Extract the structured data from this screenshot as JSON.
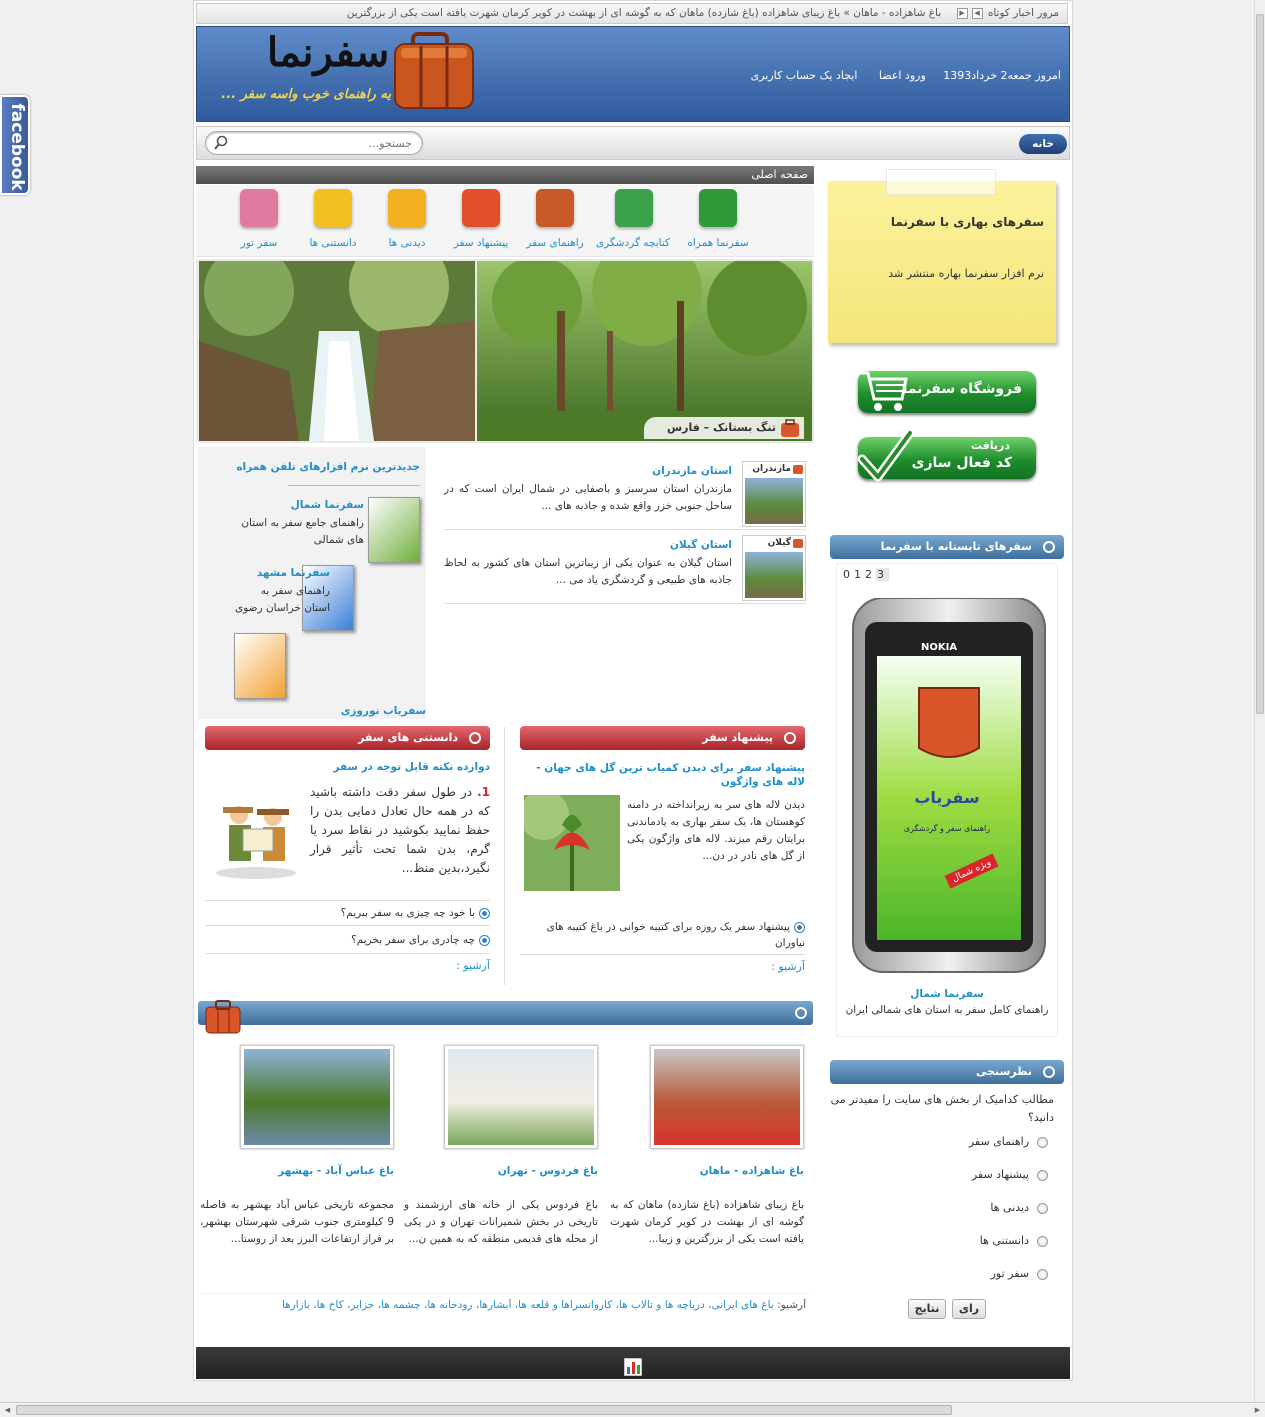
{
  "facebook": {
    "label": "facebook"
  },
  "ticker": {
    "label": "مرور اخبار کوتاه",
    "text": "باغ شاهزاده - ماهان  »  باغ زیبای شاهزاده (باغ شازده) ماهان که به گوشه ای از بهشت در کویر کرمان شهرت یافته است یکی از بزرگترین"
  },
  "header": {
    "logo_text": "سفرنما",
    "logo_slogan": "یه راهنمای خوب واسه سفر ...",
    "date": "امروز جمعه2 خرداد1393",
    "login": "ورود اعضا",
    "register": "ایجاد یک حساب کاربری"
  },
  "toolbar": {
    "home": "خانه",
    "search_placeholder": "جستجو..."
  },
  "main": {
    "breadcrumb": "صفحه اصلی",
    "categories": [
      {
        "label": "سفرنما همراه",
        "icon": "phone-suitcase-icon",
        "color": "#2e9a3a"
      },
      {
        "label": "کتابچه گردشگری",
        "icon": "book-icon",
        "color": "#3aa24a"
      },
      {
        "label": "راهنمای سفر",
        "icon": "signpost-icon",
        "color": "#c85a2a"
      },
      {
        "label": "پیشنهاد سفر",
        "icon": "bag-icon",
        "color": "#e0502a"
      },
      {
        "label": "دیدنی ها",
        "icon": "sun-cloud-icon",
        "color": "#f3b020"
      },
      {
        "label": "دانستنی ها",
        "icon": "question-icon",
        "color": "#f0c020"
      },
      {
        "label": "سفر تور",
        "icon": "backpack-icon",
        "color": "#e07aa0"
      }
    ],
    "slider_caption": "تنگ بستانک – فارس",
    "provinces": [
      {
        "tag": "مازندران",
        "title": "استان مازندران",
        "desc": "مازندران استان سرسبز و باصفایی در شمال ایران است که در ساحل جنوبی خزر واقع شده و جاذبه های ..."
      },
      {
        "tag": "گیلان",
        "title": "استان گیلان",
        "desc": "استان گیلان به عنوان یکی از زیباترین استان های کشور به لحاظ جاذبه های طبیعی و گردشگری یاد می ..."
      }
    ],
    "apps": {
      "heading": "جدیدترین نرم افزارهای تلفن همراه",
      "items": [
        {
          "title": "سفرنما شمال",
          "desc": "راهنمای جامع سفر به استان های شمالی"
        },
        {
          "title": "سفرنما مشهد",
          "desc": "راهنمای سفر به استان خراسان رضوی"
        },
        {
          "title": "سفریاب نوروزی",
          "desc": ""
        }
      ]
    },
    "suggest": {
      "heading": "پیشنهاد سفر",
      "title": "پیشنهاد سفر برای دیدن کمیاب ترین گل های جهان - لاله های واژگون",
      "body": "دیدن لاله های سر به زیرانداخته در دامنه کوهستان ها، یک سفر بهاری به یادماندنی برایتان رقم میزند. لاله های واژگون یکی از گل های نادر در دن...",
      "links": [
        "پیشنهاد سفر یک روزه برای کتیبه خوانی در باغ کتیبه های نیاوران"
      ],
      "archive": "آرشیو :"
    },
    "facts": {
      "heading": "دانستنی های سفر",
      "title": "دوازده نکته قابل توجه در سفر",
      "num": "1.",
      "body": "در طول سفر دقت داشته باشید که در همه حال تعادل دمایی بدن را حفظ نمایید بکوشید در نقاط سرد یا گرم، بدن شما تحت تأثیر قرار نگیرد،بدین منظ...",
      "links": [
        "با خود چه چیزی به سفر ببریم؟",
        "چه چادری برای سفر بخریم؟"
      ],
      "archive": "آرشیو :"
    },
    "gardens": [
      {
        "title": "باغ شاهزاده - ماهان",
        "desc": "باغ زیبای شاهزاده (باغ شازده) ماهان که به گوشه ای از بهشت در کویر کرمان شهرت یافته است یکی از بزرگترین و زیبا..."
      },
      {
        "title": "باغ فردوس - تهران",
        "desc": "باغ فردوس یکی از خانه های ارزشمند و تاریخی در بخش شمیرانات تهران و در یکی از محله های قدیمی منطقه که به همین ن..."
      },
      {
        "title": "باغ عباس آباد - بهشهر",
        "desc": "مجموعه تاریخی عباس آباد بهشهر به فاصله 9 کیلومتری جنوب شرقی شهرستان بهشهر، بر فراز ارتفاعات البرز بعد از روستا..."
      }
    ],
    "archive_label": "آرشیو:",
    "archive_links": "باغ های ایرانی، دریاچه ها و تالاب ها، کاروانسراها و قلعه ها، آبشارها، رودخانه ها، چشمه ها، جزایر، کاخ ها، بازارها"
  },
  "sidebar": {
    "note": {
      "title": "سفرهای بهاری با سفرنما",
      "body": "نرم افزار سفرنما بهاره منتشر شد"
    },
    "shop": "فروشگاه سفرنما",
    "activate_top": "دریافت",
    "activate_bottom": "کد فعال سازی",
    "summer": {
      "heading": "سفرهای تابستانه با سفرنما",
      "pager": [
        "0",
        "1",
        "2",
        "3"
      ],
      "phone_brand": "NOKIA",
      "screen_title": "سفریاب",
      "screen_sub": "راهنمای سفر و گردشگری",
      "screen_badge": "ویژه شمال",
      "title": "سفرنما شمال",
      "desc": "راهنمای کامل سفر به استان های شمالی ایران"
    },
    "poll": {
      "heading": "نظرسنجی",
      "question": "مطالب کدامیک از بخش های سایت را مفیدتر می دانید؟",
      "options": [
        "راهنمای سفر",
        "پیشنهاد سفر",
        "دیدنی ها",
        "دانستنی ها",
        "سفر تور"
      ],
      "vote": "رای",
      "results": "نتایج"
    }
  }
}
